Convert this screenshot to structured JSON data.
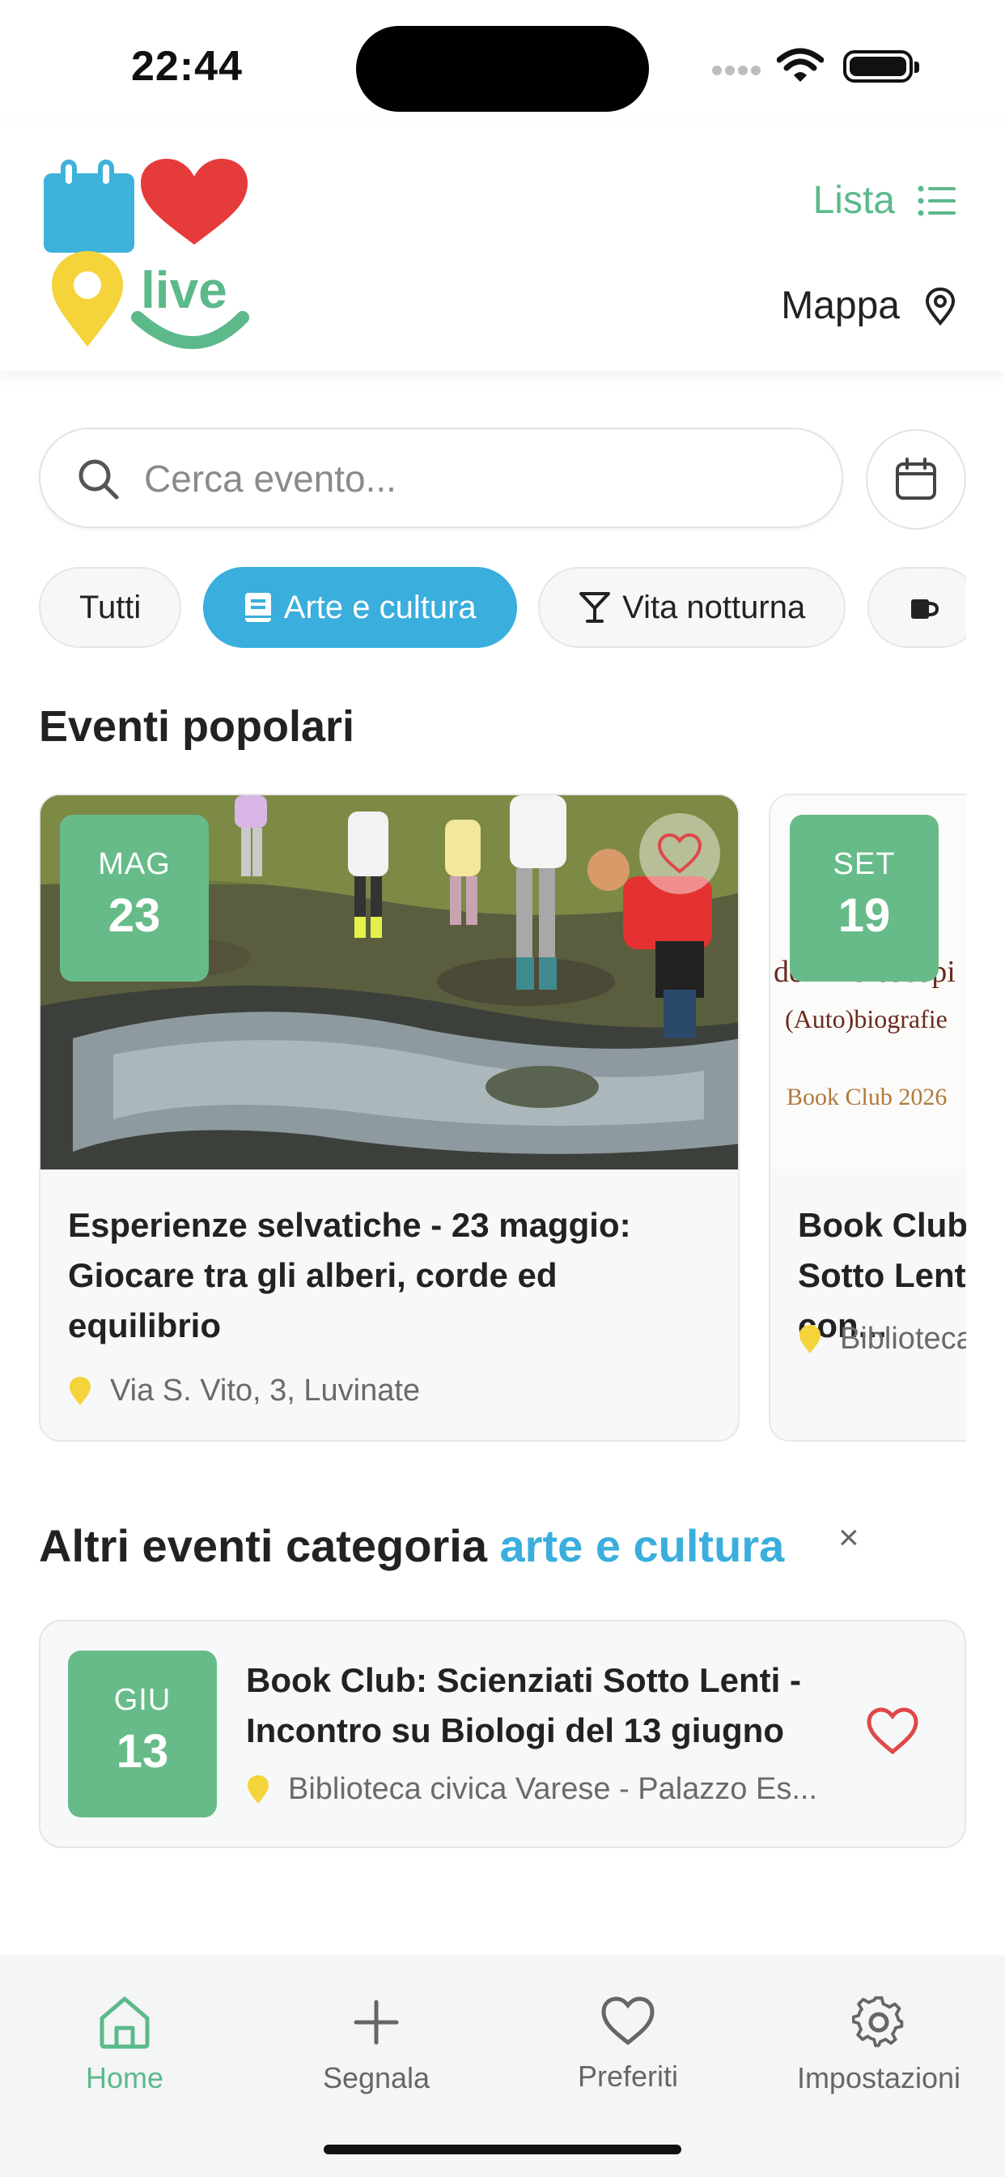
{
  "status": {
    "time": "22:44"
  },
  "header": {
    "logo_text": "live",
    "list_label": "Lista",
    "map_label": "Mappa"
  },
  "search": {
    "placeholder": "Cerca evento..."
  },
  "categories": [
    "Tutti",
    "Arte e cultura",
    "Vita notturna"
  ],
  "popular": {
    "title": "Eventi popolari",
    "events": [
      {
        "month": "MAG",
        "day": "23",
        "title": "Esperienze selvatiche - 23 maggio: Giocare tra gli alberi, corde ed equilibrio",
        "location": "Via S. Vito, 3, Luvinate"
      },
      {
        "month": "SET",
        "day": "19",
        "title": "Book Club: Scienziati Sotto Lenti - Incontro con...",
        "location": "Biblioteca civica Varese",
        "poster_lines": [
          "del microscopi",
          "(Auto)biografie",
          "Book Club 2026"
        ]
      }
    ]
  },
  "more": {
    "title_prefix": "Altri eventi categoria",
    "title_highlight": "arte e cultura",
    "close": "×",
    "events": [
      {
        "month": "GIU",
        "day": "13",
        "title": "Book Club: Scienziati Sotto Lenti - Incontro su Biologi del 13 giugno",
        "location": "Biblioteca civica Varese - Palazzo Es..."
      }
    ]
  },
  "tabs": [
    "Home",
    "Segnala",
    "Preferiti",
    "Impostazioni"
  ],
  "colors": {
    "green": "#66bb88",
    "blue": "#3aaedc",
    "heart": "#e04848",
    "yellow": "#f5d33a"
  }
}
